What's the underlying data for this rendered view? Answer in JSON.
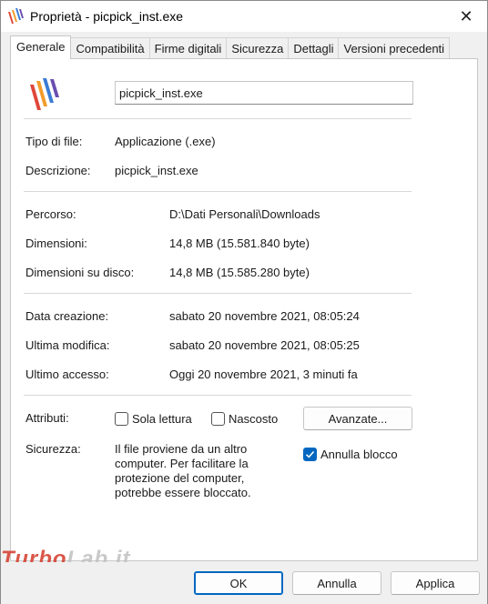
{
  "window": {
    "title": "Proprietà - picpick_inst.exe",
    "close_glyph": "✕"
  },
  "tabs": [
    {
      "label": "Generale",
      "active": true
    },
    {
      "label": "Compatibilità",
      "active": false
    },
    {
      "label": "Firme digitali",
      "active": false
    },
    {
      "label": "Sicurezza",
      "active": false
    },
    {
      "label": "Dettagli",
      "active": false
    },
    {
      "label": "Versioni precedenti",
      "active": false
    }
  ],
  "general": {
    "file_name": "picpick_inst.exe",
    "file_type_label": "Tipo di file:",
    "file_type_value": "Applicazione (.exe)",
    "description_label": "Descrizione:",
    "description_value": "picpick_inst.exe",
    "location_label": "Percorso:",
    "location_value": "D:\\Dati Personali\\Downloads",
    "size_label": "Dimensioni:",
    "size_value": "14,8 MB (15.581.840 byte)",
    "size_on_disk_label": "Dimensioni su disco:",
    "size_on_disk_value": "14,8 MB (15.585.280 byte)",
    "created_label": "Data creazione:",
    "created_value": "sabato 20 novembre 2021, 08:05:24",
    "modified_label": "Ultima modifica:",
    "modified_value": "sabato 20 novembre 2021, 08:05:25",
    "accessed_label": "Ultimo accesso:",
    "accessed_value": "Oggi 20 novembre 2021, 3 minuti fa",
    "attributes_label": "Attributi:",
    "readonly_label": "Sola lettura",
    "readonly_checked": false,
    "hidden_label": "Nascosto",
    "hidden_checked": false,
    "advanced_label": "Avanzate...",
    "security_label": "Sicurezza:",
    "security_text": "Il file proviene da un altro computer. Per facilitare la protezione del computer, potrebbe essere bloccato.",
    "unblock_label": "Annulla blocco",
    "unblock_checked": true
  },
  "footer": {
    "ok_label": "OK",
    "cancel_label": "Annulla",
    "apply_label": "Applica"
  },
  "watermark": {
    "text_a": "Turbo",
    "text_b": "Lab.it"
  },
  "colors": {
    "accent": "#0067c0",
    "icon_red": "#e0463a",
    "icon_orange": "#f29b2b",
    "icon_blue": "#3a7bd5"
  },
  "icons": {
    "app": "picpick-app-icon",
    "close": "close-icon",
    "check": "checkmark-icon"
  }
}
